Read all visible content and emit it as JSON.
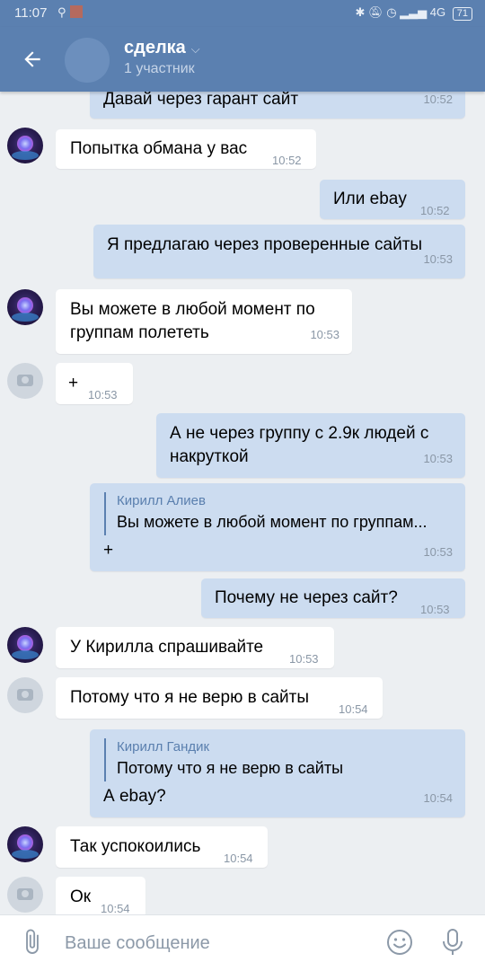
{
  "status_bar": {
    "time": "11:07",
    "battery": "71",
    "network": "4G"
  },
  "header": {
    "title": "сделка",
    "subtitle": "1 участник"
  },
  "messages": [
    {
      "text": "Давай через гарант сайт",
      "time": "10:52"
    },
    {
      "text": "Попытка обмана у вас",
      "time": "10:52"
    },
    {
      "text": "Или ebay",
      "time": "10:52"
    },
    {
      "text": "Я предлагаю через проверенные сайты",
      "time": "10:53"
    },
    {
      "text": "Вы можете в любой момент по",
      "text2": "группам полететь",
      "time": "10:53"
    },
    {
      "text": "+",
      "time": "10:53"
    },
    {
      "text": "А не через группу с 2.9к людей с",
      "text2": "накруткой",
      "time": "10:53"
    },
    {
      "quote_name": "Кирилл Алиев",
      "quote_text": "Вы можете в любой момент по группам...",
      "text": "+",
      "time": "10:53"
    },
    {
      "text": "Почему не через сайт?",
      "time": "10:53"
    },
    {
      "text": "У Кирилла спрашивайте",
      "time": "10:53"
    },
    {
      "text": "Потому что я не верю в сайты",
      "time": "10:54"
    },
    {
      "quote_name": "Кирилл Гандик",
      "quote_text": "Потому что я не верю в сайты",
      "text": "А ebay?",
      "time": "10:54"
    },
    {
      "text": "Так успокоились",
      "time": "10:54"
    },
    {
      "text": "Ок",
      "time": "10:54"
    }
  ],
  "input": {
    "placeholder": "Ваше сообщение"
  },
  "colors": {
    "header": "#5b80b0",
    "background": "#eceff2",
    "outgoing_bubble": "#ccdcf0",
    "incoming_bubble": "#ffffff",
    "accent": "#5a7fae"
  },
  "icons": {
    "back": "arrow-left-icon",
    "attach": "paperclip-icon",
    "emoji": "smile-icon",
    "mic": "microphone-icon",
    "camera": "camera-icon"
  }
}
